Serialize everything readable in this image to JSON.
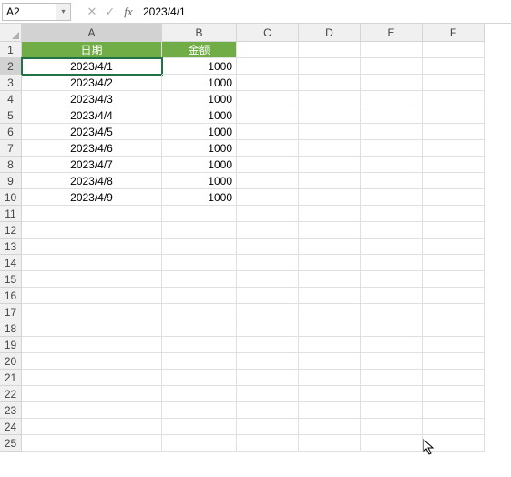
{
  "formulaBar": {
    "nameBox": "A2",
    "formulaValue": "2023/4/1",
    "fxLabel": "fx"
  },
  "columns": [
    "A",
    "B",
    "C",
    "D",
    "E",
    "F"
  ],
  "activeCell": "A2",
  "headers": {
    "A": "日期",
    "B": "金额"
  },
  "rows": [
    {
      "n": 1
    },
    {
      "n": 2,
      "A": "2023/4/1",
      "B": "1000"
    },
    {
      "n": 3,
      "A": "2023/4/2",
      "B": "1000"
    },
    {
      "n": 4,
      "A": "2023/4/3",
      "B": "1000"
    },
    {
      "n": 5,
      "A": "2023/4/4",
      "B": "1000"
    },
    {
      "n": 6,
      "A": "2023/4/5",
      "B": "1000"
    },
    {
      "n": 7,
      "A": "2023/4/6",
      "B": "1000"
    },
    {
      "n": 8,
      "A": "2023/4/7",
      "B": "1000"
    },
    {
      "n": 9,
      "A": "2023/4/8",
      "B": "1000"
    },
    {
      "n": 10,
      "A": "2023/4/9",
      "B": "1000"
    },
    {
      "n": 11
    },
    {
      "n": 12
    },
    {
      "n": 13
    },
    {
      "n": 14
    },
    {
      "n": 15
    },
    {
      "n": 16
    },
    {
      "n": 17
    },
    {
      "n": 18
    },
    {
      "n": 19
    },
    {
      "n": 20
    },
    {
      "n": 21
    },
    {
      "n": 22
    },
    {
      "n": 23
    },
    {
      "n": 24
    },
    {
      "n": 25
    }
  ],
  "chart_data": {
    "type": "table",
    "columns": [
      "日期",
      "金额"
    ],
    "data": [
      [
        "2023/4/1",
        1000
      ],
      [
        "2023/4/2",
        1000
      ],
      [
        "2023/4/3",
        1000
      ],
      [
        "2023/4/4",
        1000
      ],
      [
        "2023/4/5",
        1000
      ],
      [
        "2023/4/6",
        1000
      ],
      [
        "2023/4/7",
        1000
      ],
      [
        "2023/4/8",
        1000
      ],
      [
        "2023/4/9",
        1000
      ]
    ]
  }
}
